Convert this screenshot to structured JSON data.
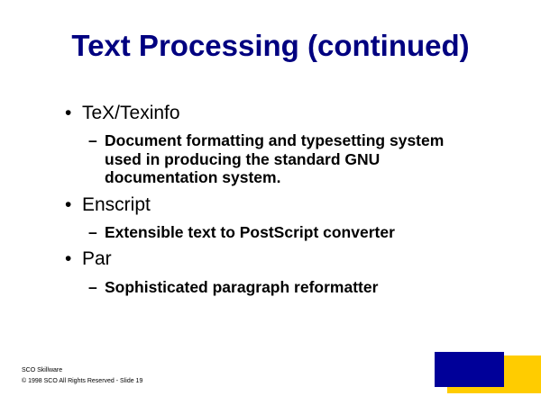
{
  "title": "Text Processing (continued)",
  "bullet_glyph": "•",
  "dash_glyph": "–",
  "items": [
    {
      "label": "TeX/Texinfo",
      "sub": "Document formatting and typesetting system used in producing the standard GNU documentation system."
    },
    {
      "label": "Enscript",
      "sub": "Extensible text to PostScript converter"
    },
    {
      "label": "Par",
      "sub": "Sophisticated paragraph reformatter"
    }
  ],
  "footer": {
    "line1": "SCO Skillware",
    "line2": "© 1998 SCO  All Rights Reserved - Slide 19"
  },
  "colors": {
    "title": "#000080",
    "blue_block": "#000099",
    "yellow_block": "#ffcc00"
  }
}
